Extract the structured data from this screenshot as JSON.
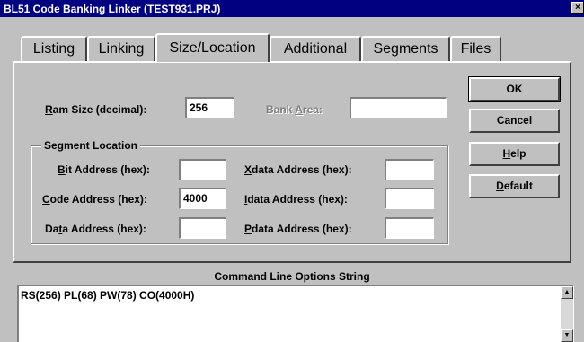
{
  "window": {
    "title": "BL51 Code Banking Linker (TEST931.PRJ)",
    "close_glyph": "×"
  },
  "tabs": [
    {
      "label": "Listing"
    },
    {
      "label": "Linking"
    },
    {
      "label": "Size/Location",
      "active": true
    },
    {
      "label": "Additional"
    },
    {
      "label": "Segments"
    },
    {
      "label": "Files"
    }
  ],
  "ram": {
    "label_pre": "",
    "label_u": "R",
    "label_post": "am Size (decimal):",
    "value": "256"
  },
  "bank": {
    "label_pre": "Bank ",
    "label_u": "A",
    "label_post": "rea:",
    "value": ""
  },
  "segment": {
    "title": "Segment Location",
    "bit": {
      "label_pre": "",
      "label_u": "B",
      "label_post": "it Address (hex):",
      "value": ""
    },
    "code": {
      "label_pre": "",
      "label_u": "C",
      "label_post": "ode Address (hex):",
      "value": "4000"
    },
    "data": {
      "label_pre": "Da",
      "label_u": "t",
      "label_post": "a Address (hex):",
      "value": ""
    },
    "xdata": {
      "label_pre": "",
      "label_u": "X",
      "label_post": "data Address (hex):",
      "value": ""
    },
    "idata": {
      "label_pre": "",
      "label_u": "I",
      "label_post": "data Address (hex):",
      "value": ""
    },
    "pdata": {
      "label_pre": "",
      "label_u": "P",
      "label_post": "data Address (hex):",
      "value": ""
    }
  },
  "buttons": {
    "ok": {
      "label": "OK"
    },
    "cancel": {
      "label": "Cancel"
    },
    "help": {
      "label_pre": "",
      "label_u": "H",
      "label_post": "elp"
    },
    "default": {
      "label_pre": "",
      "label_u": "D",
      "label_post": "efault"
    }
  },
  "command": {
    "label": "Command Line Options String",
    "value": "RS(256) PL(68) PW(78) CO(4000H)"
  },
  "icons": {
    "scroll_up": "▲",
    "scroll_down": "▼"
  }
}
